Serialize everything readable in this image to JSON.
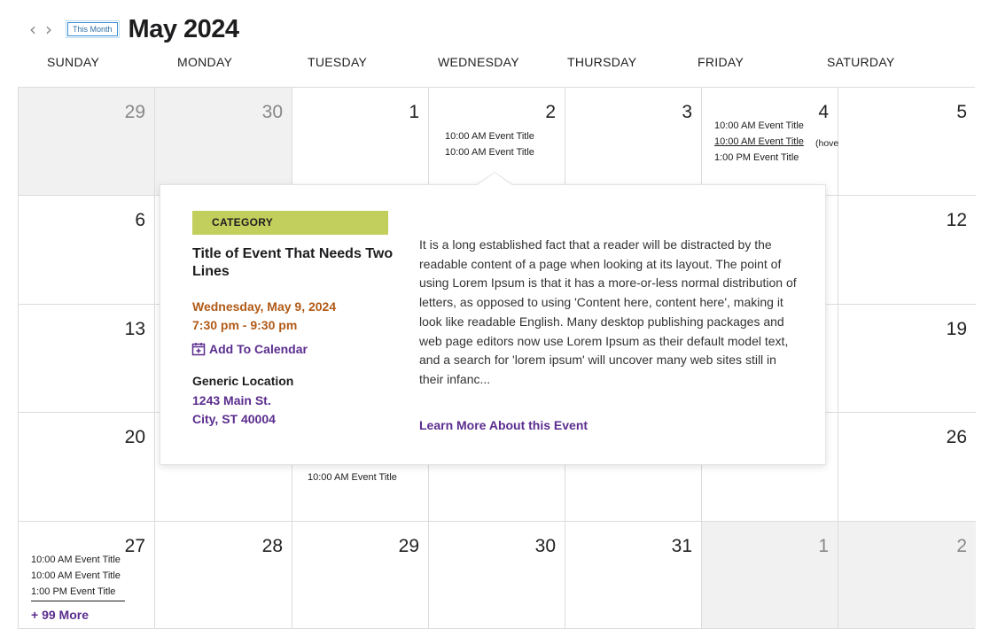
{
  "header": {
    "this_month_label": "This Month",
    "month_title": "May 2024"
  },
  "weekdays": [
    "SUNDAY",
    "MONDAY",
    "TUESDAY",
    "WEDNESDAY",
    "THURSDAY",
    "FRIDAY",
    "SATURDAY"
  ],
  "weeks": [
    [
      "29",
      "30",
      "1",
      "2",
      "3",
      "4",
      "5"
    ],
    [
      "6",
      "",
      "",
      "",
      "",
      "",
      "12"
    ],
    [
      "13",
      "",
      "",
      "",
      "",
      "",
      "19"
    ],
    [
      "20",
      "",
      "",
      "",
      "",
      "",
      "26"
    ],
    [
      "27",
      "28",
      "29",
      "30",
      "31",
      "1",
      "2"
    ]
  ],
  "events": {
    "wed_2": [
      "10:00 AM Event Title",
      "10:00 AM Event Title"
    ],
    "fri_4": [
      "10:00 AM Event Title",
      "10:00 AM Event Title",
      "1:00 PM Event Title"
    ],
    "fri_4_hover_note": "(hover)",
    "tue_21": [
      "10:00 AM Event Title"
    ],
    "sun_27": [
      "10:00 AM Event Title",
      "10:00 AM Event Title",
      "1:00 PM Event Title"
    ],
    "sun_27_more": "+ 99 More"
  },
  "popup": {
    "category": "CATEGORY",
    "title": "Title of Event That Needs Two Lines",
    "date": "Wednesday, May 9, 2024",
    "time": "7:30 pm - 9:30 pm",
    "add_to_calendar": "Add To Calendar",
    "location_name": "Generic Location",
    "address_line1": "1243 Main St.",
    "address_line2": "City, ST 40004",
    "description": "It is a long established fact that a reader will be distracted by the readable content of a page when looking at its layout. The point of using Lorem Ipsum is that it has a more-or-less normal distribution of letters, as opposed to using 'Content here, content here', making it look like readable English. Many desktop publishing packages and web page editors now use Lorem Ipsum as their default model text, and a search for 'lorem ipsum' will uncover many web sites still in their infanc...",
    "learn_more": "Learn More About this Event"
  },
  "colors": {
    "accent_purple": "#5b2d8e",
    "date_orange": "#b15a17",
    "category_green": "#c3cf5c",
    "muted_cell": "#f1f1f2"
  }
}
